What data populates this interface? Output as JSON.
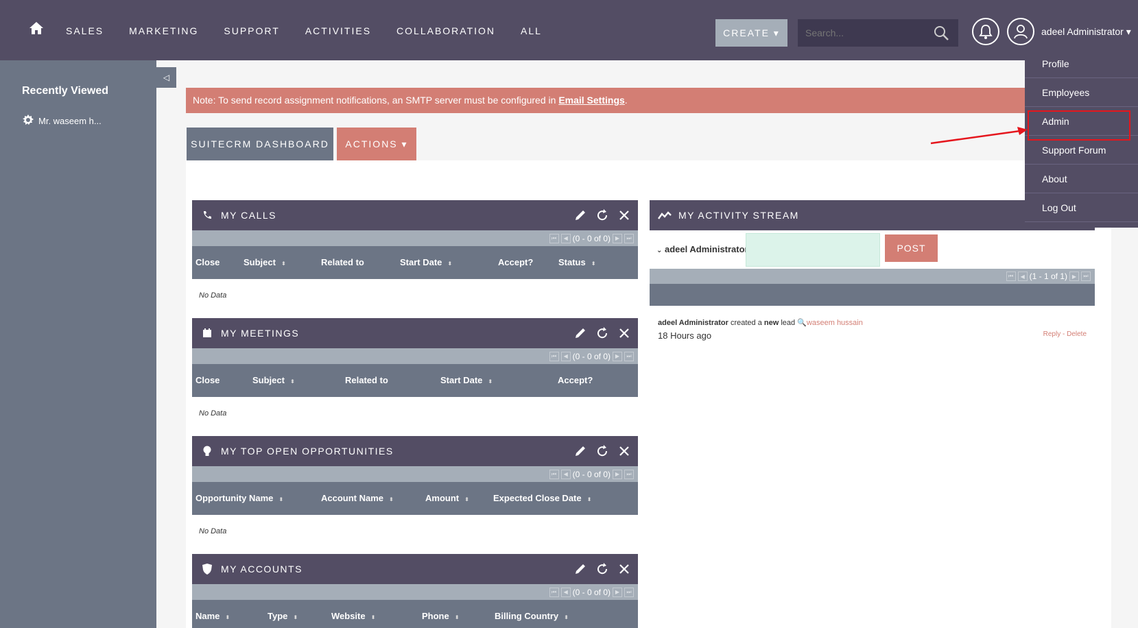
{
  "nav": {
    "items": [
      "SALES",
      "MARKETING",
      "SUPPORT",
      "ACTIVITIES",
      "COLLABORATION",
      "ALL"
    ],
    "create_label": "CREATE ▾",
    "search_placeholder": "Search...",
    "user_name": "adeel Administrator ▾"
  },
  "user_menu": {
    "items": [
      "Profile",
      "Employees",
      "Admin",
      "Support Forum",
      "About",
      "Log Out"
    ]
  },
  "sidebar": {
    "title": "Recently Viewed",
    "items": [
      "Mr. waseem h..."
    ],
    "toggle": "◁"
  },
  "alert": {
    "text": "Note: To send record assignment notifications, an SMTP server must be configured in ",
    "link": "Email Settings",
    "suffix": "."
  },
  "tabs": {
    "dashboard": "SUITECRM DASHBOARD",
    "actions": "ACTIONS ▾"
  },
  "dashlets": [
    {
      "title": "MY CALLS",
      "pager": "(0 - 0 of 0)",
      "columns": [
        "Close",
        "Subject",
        "Related to",
        "Start Date",
        "Accept?",
        "Status"
      ],
      "empty": "No Data"
    },
    {
      "title": "MY MEETINGS",
      "pager": "(0 - 0 of 0)",
      "columns": [
        "Close",
        "Subject",
        "Related to",
        "Start Date",
        "Accept?"
      ],
      "empty": "No Data"
    },
    {
      "title": "MY TOP OPEN OPPORTUNITIES",
      "pager": "(0 - 0 of 0)",
      "columns": [
        "Opportunity Name",
        "Account Name",
        "Amount",
        "Expected Close Date"
      ],
      "empty": "No Data"
    },
    {
      "title": "MY ACCOUNTS",
      "pager": "(0 - 0 of 0)",
      "columns": [
        "Name",
        "Type",
        "Website",
        "Phone",
        "Billing Country"
      ]
    }
  ],
  "activity": {
    "title": "MY ACTIVITY STREAM",
    "user": "adeel Administrator",
    "post": "POST",
    "pager": "(1 - 1 of 1)",
    "entry": {
      "user": "adeel Administrator",
      "action_pre": " created a ",
      "action_new": "new",
      "action_post": " lead ",
      "lead": "waseem hussain",
      "time": "18 Hours ago",
      "reply": "Reply",
      "sep": " - ",
      "delete": "Delete"
    }
  },
  "colors": {
    "nav_bg": "#534d64",
    "sidebar_bg": "#6c7585",
    "accent": "#d37e74",
    "highlight": "#e5161d"
  }
}
